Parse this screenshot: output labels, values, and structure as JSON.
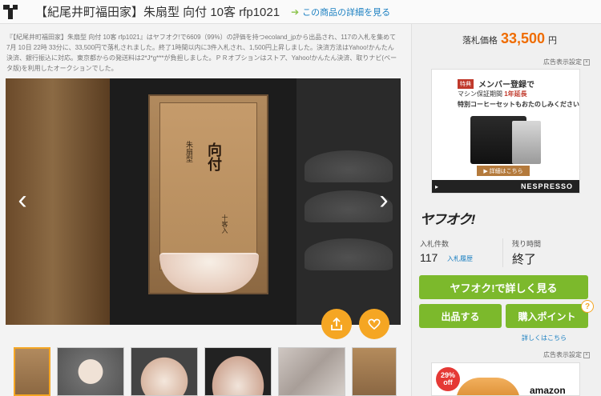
{
  "header": {
    "title": "【紀尾井町福田家】朱扇型 向付 10客 rfp1021",
    "detail_link": "この商品の詳細を見る"
  },
  "description": "『【紀尾井町福田家】朱扇型 向付 10客 rfp1021』はヤフオク!で6609（99%）の評価を持つecoland_jpから出品され、117の入札を集めて7月 10日 22時 33分に、33,500円で落札されました。終了1時間以内に3件入札され、1,500円上昇しました。決済方法はYahoo!かんたん決済、銀行振込に対応。東京都からの発送料は2*J*g***が負担しました。ＰＲオプションはストア、Yahoo!かんたん決済、取りナビ(ベータ版)を利用したオークションでした。",
  "image": {
    "box_title": "向付",
    "box_subtitle": "朱扇型",
    "box_sign": "十客入",
    "prev_symbol": "‹",
    "next_symbol": "›"
  },
  "price": {
    "label": "落札価格",
    "value": "33,500",
    "unit": "円"
  },
  "ad_label": "広告表示設定",
  "ad1": {
    "tokuten": "特典",
    "member": "メンバー登録で",
    "line2_pre": "マシン保証期間",
    "line2_bold": "1年延長",
    "line3": "特別コーヒーセットもおたのしみください",
    "detail_btn": "▶ 詳細はこちら",
    "brand": "NESPRESSO"
  },
  "yafuoku": {
    "logo": "ヤフオク!",
    "bids_label": "入札件数",
    "bids_value": "117",
    "bids_link": "入札履歴",
    "time_label": "残り時間",
    "time_value": "終了"
  },
  "buttons": {
    "big": "ヤフオク!で詳しく見る",
    "sell": "出品する",
    "point": "購入ポイント",
    "qmark": "?",
    "more": "詳しくはこちら"
  },
  "ad2": {
    "badge_pct": "29%",
    "badge_off": "off",
    "brand": "amazon"
  },
  "colors": {
    "accent_orange": "#ef6c00",
    "button_green": "#7cb92c",
    "link_blue": "#1a7fc1",
    "round_btn": "#f5a623"
  }
}
